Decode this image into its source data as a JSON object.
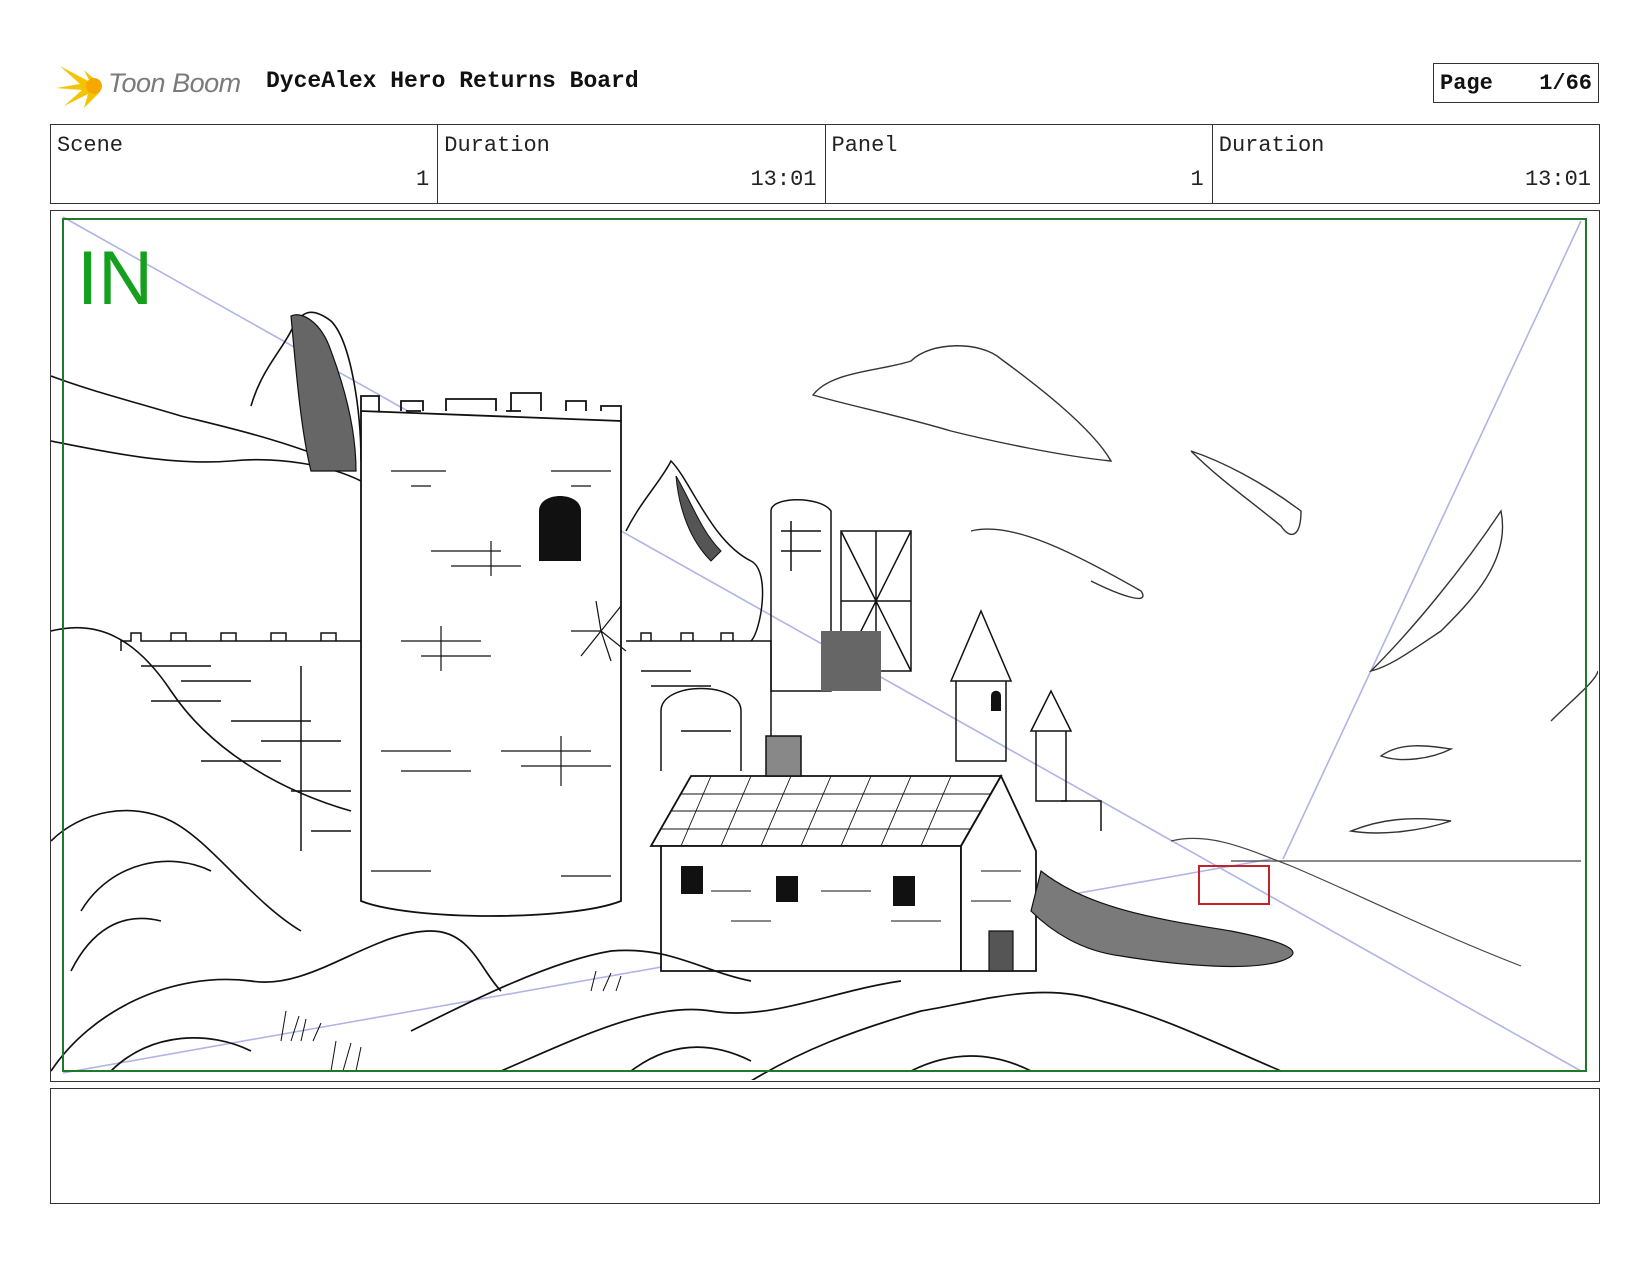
{
  "header": {
    "logo_text": "Toon Boom",
    "board_title": "DyceAlex Hero Returns Board",
    "page_label": "Page",
    "page_value": "1/66"
  },
  "info": {
    "scene_label": "Scene",
    "scene_value": "1",
    "scene_duration_label": "Duration",
    "scene_duration_value": "13:01",
    "panel_label": "Panel",
    "panel_value": "1",
    "panel_duration_label": "Duration",
    "panel_duration_value": "13:01"
  },
  "panel": {
    "transition_label": "IN",
    "safe_frame_color": "#1e7a2a",
    "transition_color": "#14a01e",
    "camera_box_color": "#c0242a",
    "guide_line_color": "#b0b4e6"
  },
  "notes": {
    "text": ""
  }
}
